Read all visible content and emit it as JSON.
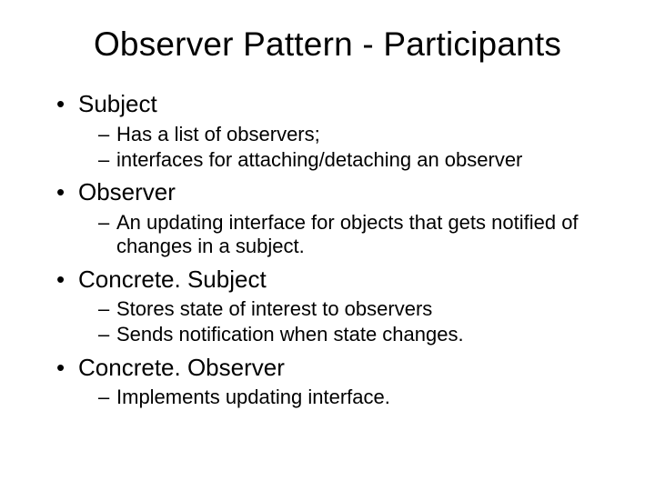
{
  "title": "Observer Pattern - Participants",
  "items": [
    {
      "label": "Subject",
      "sub": [
        "Has a list of observers;",
        "interfaces for attaching/detaching an observer"
      ]
    },
    {
      "label": "Observer",
      "sub": [
        "An updating interface for objects that gets notified of changes in a subject."
      ]
    },
    {
      "label": "Concrete. Subject",
      "sub": [
        "Stores state of interest to observers",
        "Sends notification when state changes."
      ]
    },
    {
      "label": "Concrete. Observer",
      "sub": [
        "Implements updating interface."
      ]
    }
  ]
}
